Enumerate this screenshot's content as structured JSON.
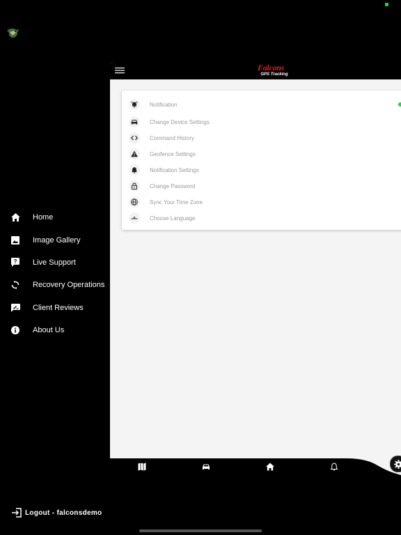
{
  "drawer": {
    "items": [
      {
        "label": "Home",
        "icon": "home-icon"
      },
      {
        "label": "Image Gallery",
        "icon": "image-icon"
      },
      {
        "label": "Live Support",
        "icon": "help-icon"
      },
      {
        "label": "Recovery Operations",
        "icon": "sync-icon"
      },
      {
        "label": "Client Reviews",
        "icon": "review-icon"
      },
      {
        "label": "About Us",
        "icon": "info-icon"
      }
    ],
    "logout_label": "Logout - falconsdemo"
  },
  "header": {
    "brand_name": "Falcons",
    "brand_tagline": "GPS Tracking"
  },
  "settings": {
    "items": [
      {
        "label": "Notification",
        "icon": "alarm-icon"
      },
      {
        "label": "Change Device Settings",
        "icon": "car-icon"
      },
      {
        "label": "Command History",
        "icon": "code-icon"
      },
      {
        "label": "Geofence Settings",
        "icon": "warning-icon"
      },
      {
        "label": "Notification Settings",
        "icon": "bell-icon"
      },
      {
        "label": "Change Password",
        "icon": "lock-icon"
      },
      {
        "label": "Sync Your Time Zone",
        "icon": "globe-icon"
      },
      {
        "label": "Choose Language",
        "icon": "language-icon"
      }
    ]
  },
  "bottom_nav": {
    "items": [
      "map-icon",
      "car-icon",
      "home-icon",
      "bell-icon",
      "gear-icon"
    ]
  },
  "colors": {
    "background": "#000000",
    "panel": "#f4f4f4",
    "brand_red": "#d41f2b",
    "toggle_green": "#2ecc40",
    "muted_text": "#9a9a9a"
  }
}
